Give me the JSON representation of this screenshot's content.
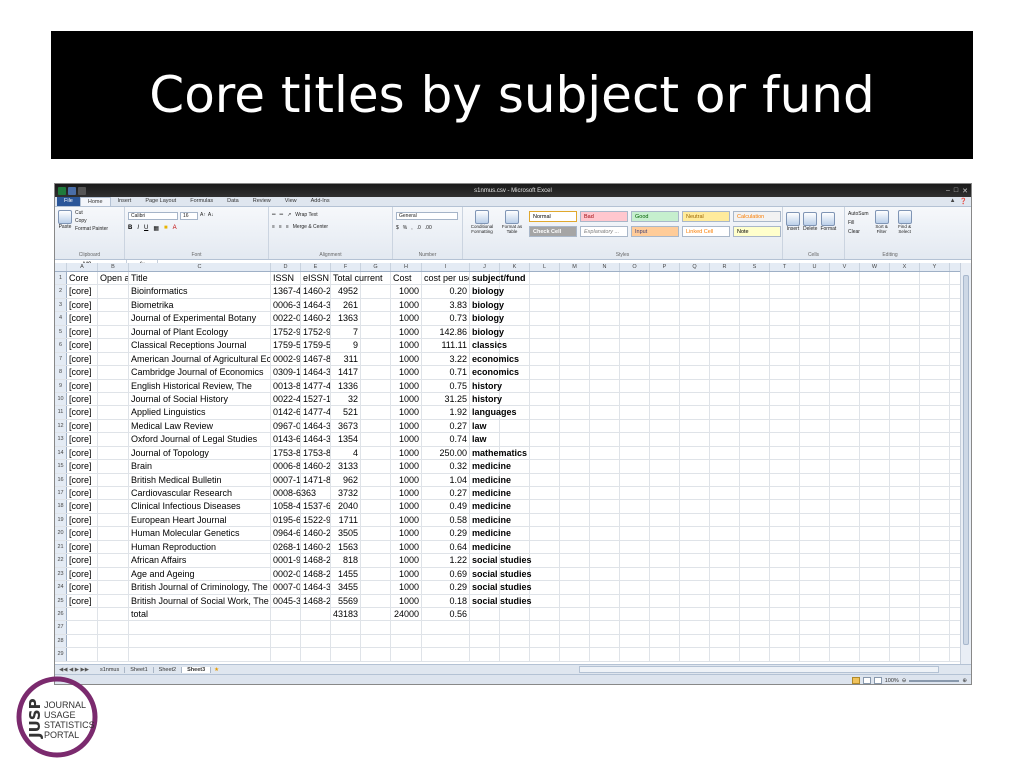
{
  "slide": {
    "title": "Core titles by subject or fund"
  },
  "excel": {
    "window_title": "s1nmus.csv - Microsoft Excel",
    "tabs": [
      "File",
      "Home",
      "Insert",
      "Page Layout",
      "Formulas",
      "Data",
      "Review",
      "View",
      "Add-Ins"
    ],
    "active_tab": "Home",
    "ribbon": {
      "clipboard": {
        "paste": "Paste",
        "cut": "Cut",
        "copy": "Copy",
        "format_painter": "Format Painter",
        "label": "Clipboard"
      },
      "font": {
        "name": "Calibri",
        "size": "16",
        "label": "Font"
      },
      "alignment": {
        "wrap": "Wrap Text",
        "merge": "Merge & Center",
        "label": "Alignment"
      },
      "number": {
        "format": "General",
        "label": "Number"
      },
      "styles": {
        "conditional": "Conditional Formatting",
        "format_table": "Format as Table",
        "label": "Styles",
        "cells": [
          {
            "name": "Normal",
            "bg": "#ffffff",
            "fg": "#000000"
          },
          {
            "name": "Bad",
            "bg": "#ffc7ce",
            "fg": "#9c0006"
          },
          {
            "name": "Good",
            "bg": "#c6efce",
            "fg": "#006100"
          },
          {
            "name": "Neutral",
            "bg": "#ffeb9c",
            "fg": "#9c6500"
          },
          {
            "name": "Calculation",
            "bg": "#f2f2f2",
            "fg": "#fa7d00"
          },
          {
            "name": "Check Cell",
            "bg": "#a5a5a5",
            "fg": "#ffffff"
          },
          {
            "name": "Explanatory ...",
            "bg": "#ffffff",
            "fg": "#7f7f7f"
          },
          {
            "name": "Input",
            "bg": "#ffcc99",
            "fg": "#3f3f76"
          },
          {
            "name": "Linked Cell",
            "bg": "#ffffff",
            "fg": "#fa7d00"
          },
          {
            "name": "Note",
            "bg": "#ffffcc",
            "fg": "#000000"
          }
        ]
      },
      "cells_group": {
        "insert": "Insert",
        "delete": "Delete",
        "format": "Format",
        "label": "Cells"
      },
      "editing": {
        "autosum": "AutoSum",
        "fill": "Fill",
        "clear": "Clear",
        "sort": "Sort & Filter",
        "find": "Find & Select",
        "label": "Editing"
      }
    },
    "name_box": "M9",
    "fx": "fx",
    "columns": [
      "A",
      "B",
      "C",
      "D",
      "E",
      "F",
      "G",
      "H",
      "I",
      "J",
      "K",
      "L",
      "M",
      "N",
      "O",
      "P",
      "Q",
      "R",
      "S",
      "T",
      "U",
      "V",
      "W",
      "X",
      "Y"
    ],
    "header_row": {
      "num": "1",
      "core": "Core",
      "open": "Open a",
      "title": "Title",
      "issn": "ISSN",
      "eissn": "eISSN",
      "total": "Total current",
      "cost": "Cost",
      "cpu": "cost per use",
      "subject": "subject/fund"
    },
    "rows": [
      {
        "num": "2",
        "core": "[core]",
        "title": "Bioinformatics",
        "issn": "1367-4",
        "eissn": "1460-2",
        "total": "4952",
        "cost": "1000",
        "cpu": "0.20",
        "subject": "biology"
      },
      {
        "num": "3",
        "core": "[core]",
        "title": "Biometrika",
        "issn": "0006-3",
        "eissn": "1464-3",
        "total": "261",
        "cost": "1000",
        "cpu": "3.83",
        "subject": "biology"
      },
      {
        "num": "4",
        "core": "[core]",
        "title": "Journal of Experimental Botany",
        "issn": "0022-0",
        "eissn": "1460-2",
        "total": "1363",
        "cost": "1000",
        "cpu": "0.73",
        "subject": "biology"
      },
      {
        "num": "5",
        "core": "[core]",
        "title": "Journal of Plant Ecology",
        "issn": "1752-9",
        "eissn": "1752-9",
        "total": "7",
        "cost": "1000",
        "cpu": "142.86",
        "subject": "biology"
      },
      {
        "num": "6",
        "core": "[core]",
        "title": "Classical Receptions Journal",
        "issn": "1759-5",
        "eissn": "1759-5",
        "total": "9",
        "cost": "1000",
        "cpu": "111.11",
        "subject": "classics"
      },
      {
        "num": "7",
        "core": "[core]",
        "title": "American Journal of Agricultural Ec",
        "issn": "0002-9",
        "eissn": "1467-8",
        "total": "311",
        "cost": "1000",
        "cpu": "3.22",
        "subject": "economics"
      },
      {
        "num": "8",
        "core": "[core]",
        "title": "Cambridge Journal of Economics",
        "issn": "0309-1",
        "eissn": "1464-3",
        "total": "1417",
        "cost": "1000",
        "cpu": "0.71",
        "subject": "economics"
      },
      {
        "num": "9",
        "core": "[core]",
        "title": "English Historical Review, The",
        "issn": "0013-8",
        "eissn": "1477-4",
        "total": "1336",
        "cost": "1000",
        "cpu": "0.75",
        "subject": "history"
      },
      {
        "num": "10",
        "core": "[core]",
        "title": "Journal of Social History",
        "issn": "0022-4",
        "eissn": "1527-1",
        "total": "32",
        "cost": "1000",
        "cpu": "31.25",
        "subject": "history"
      },
      {
        "num": "11",
        "core": "[core]",
        "title": "Applied Linguistics",
        "issn": "0142-6",
        "eissn": "1477-4",
        "total": "521",
        "cost": "1000",
        "cpu": "1.92",
        "subject": "languages"
      },
      {
        "num": "12",
        "core": "[core]",
        "title": "Medical Law Review",
        "issn": "0967-0",
        "eissn": "1464-3",
        "total": "3673",
        "cost": "1000",
        "cpu": "0.27",
        "subject": "law"
      },
      {
        "num": "13",
        "core": "[core]",
        "title": "Oxford Journal of Legal Studies",
        "issn": "0143-6",
        "eissn": "1464-3",
        "total": "1354",
        "cost": "1000",
        "cpu": "0.74",
        "subject": "law"
      },
      {
        "num": "14",
        "core": "[core]",
        "title": "Journal of Topology",
        "issn": "1753-8",
        "eissn": "1753-8",
        "total": "4",
        "cost": "1000",
        "cpu": "250.00",
        "subject": "mathematics"
      },
      {
        "num": "15",
        "core": "[core]",
        "title": "Brain",
        "issn": "0006-8",
        "eissn": "1460-2",
        "total": "3133",
        "cost": "1000",
        "cpu": "0.32",
        "subject": "medicine"
      },
      {
        "num": "16",
        "core": "[core]",
        "title": "British Medical Bulletin",
        "issn": "0007-1",
        "eissn": "1471-8",
        "total": "962",
        "cost": "1000",
        "cpu": "1.04",
        "subject": "medicine"
      },
      {
        "num": "17",
        "core": "[core]",
        "title": "Cardiovascular Research",
        "issn": "0008-6363",
        "eissn": "",
        "total": "3732",
        "cost": "1000",
        "cpu": "0.27",
        "subject": "medicine"
      },
      {
        "num": "18",
        "core": "[core]",
        "title": "Clinical Infectious Diseases",
        "issn": "1058-4",
        "eissn": "1537-6",
        "total": "2040",
        "cost": "1000",
        "cpu": "0.49",
        "subject": "medicine"
      },
      {
        "num": "19",
        "core": "[core]",
        "title": "European Heart Journal",
        "issn": "0195-6",
        "eissn": "1522-9",
        "total": "1711",
        "cost": "1000",
        "cpu": "0.58",
        "subject": "medicine"
      },
      {
        "num": "20",
        "core": "[core]",
        "title": "Human Molecular Genetics",
        "issn": "0964-6",
        "eissn": "1460-2",
        "total": "3505",
        "cost": "1000",
        "cpu": "0.29",
        "subject": "medicine"
      },
      {
        "num": "21",
        "core": "[core]",
        "title": "Human Reproduction",
        "issn": "0268-1",
        "eissn": "1460-2",
        "total": "1563",
        "cost": "1000",
        "cpu": "0.64",
        "subject": "medicine"
      },
      {
        "num": "22",
        "core": "[core]",
        "title": "African Affairs",
        "issn": "0001-9",
        "eissn": "1468-2",
        "total": "818",
        "cost": "1000",
        "cpu": "1.22",
        "subject": "social studies"
      },
      {
        "num": "23",
        "core": "[core]",
        "title": "Age and Ageing",
        "issn": "0002-0",
        "eissn": "1468-2",
        "total": "1455",
        "cost": "1000",
        "cpu": "0.69",
        "subject": "social studies"
      },
      {
        "num": "24",
        "core": "[core]",
        "title": "British Journal of Criminology, The",
        "issn": "0007-0",
        "eissn": "1464-3",
        "total": "3455",
        "cost": "1000",
        "cpu": "0.29",
        "subject": "social studies"
      },
      {
        "num": "25",
        "core": "[core]",
        "title": "British Journal of Social Work, The",
        "issn": "0045-3",
        "eissn": "1468-2",
        "total": "5569",
        "cost": "1000",
        "cpu": "0.18",
        "subject": "social studies"
      }
    ],
    "total_row": {
      "num": "26",
      "label": "total",
      "total": "43183",
      "cost": "24000",
      "cpu": "0.56"
    },
    "empty_rows": [
      "27",
      "28",
      "29"
    ],
    "sheet_tabs": [
      "s1nmus",
      "Sheet1",
      "Sheet2",
      "Sheet3"
    ],
    "active_sheet": "Sheet3",
    "zoom": "100%"
  },
  "logo": {
    "text_lines": [
      "JOURNAL",
      "USAGE",
      "STATISTICS",
      "PORTAL"
    ],
    "mark": "JUSP",
    "color": "#7b2a6e"
  }
}
